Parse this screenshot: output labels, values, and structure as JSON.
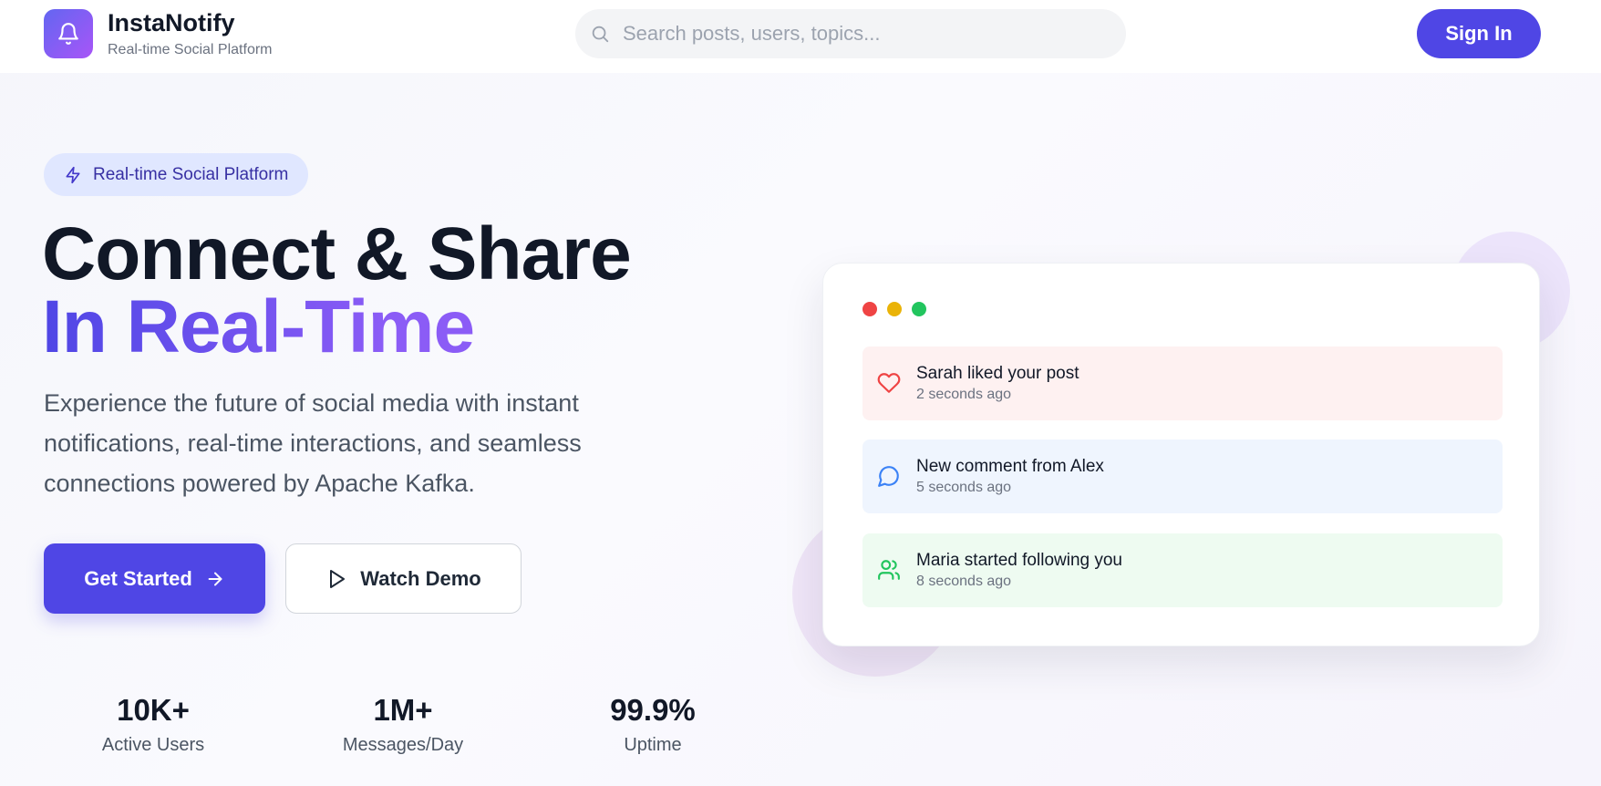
{
  "header": {
    "brand_name": "InstaNotify",
    "brand_sub": "Real-time Social Platform",
    "search_placeholder": "Search posts, users, topics...",
    "signin_label": "Sign In",
    "logo_icon": "bell-icon"
  },
  "hero": {
    "badge": "Real-time Social Platform",
    "title_line1": "Connect & Share",
    "title_line2": "In Real-Time",
    "lead": "Experience the future of social media with instant notifications, real-time interactions, and seamless connections powered by Apache Kafka.",
    "primary_cta": "Get Started",
    "secondary_cta": "Watch Demo"
  },
  "stats": [
    {
      "value": "10K+",
      "label": "Active Users"
    },
    {
      "value": "1M+",
      "label": "Messages/Day"
    },
    {
      "value": "99.9%",
      "label": "Uptime"
    }
  ],
  "preview": {
    "window_dots": [
      "#ef4444",
      "#eab308",
      "#22c55e"
    ],
    "notifications": [
      {
        "title": "Sarah liked your post",
        "time": "2 seconds ago",
        "icon": "heart-icon",
        "bg": "#fef1f1",
        "color": "#ef4444"
      },
      {
        "title": "New comment from Alex",
        "time": "5 seconds ago",
        "icon": "chat-bubble-icon",
        "bg": "#eff5fe",
        "color": "#3b82f6"
      },
      {
        "title": "Maria started following you",
        "time": "8 seconds ago",
        "icon": "users-icon",
        "bg": "#eefbf1",
        "color": "#22c55e"
      }
    ]
  },
  "colors": {
    "primary": "#4f46e5",
    "accent_gradient_end": "#8b5cf6",
    "text_dark": "#111827",
    "text_muted": "#6b7280"
  }
}
